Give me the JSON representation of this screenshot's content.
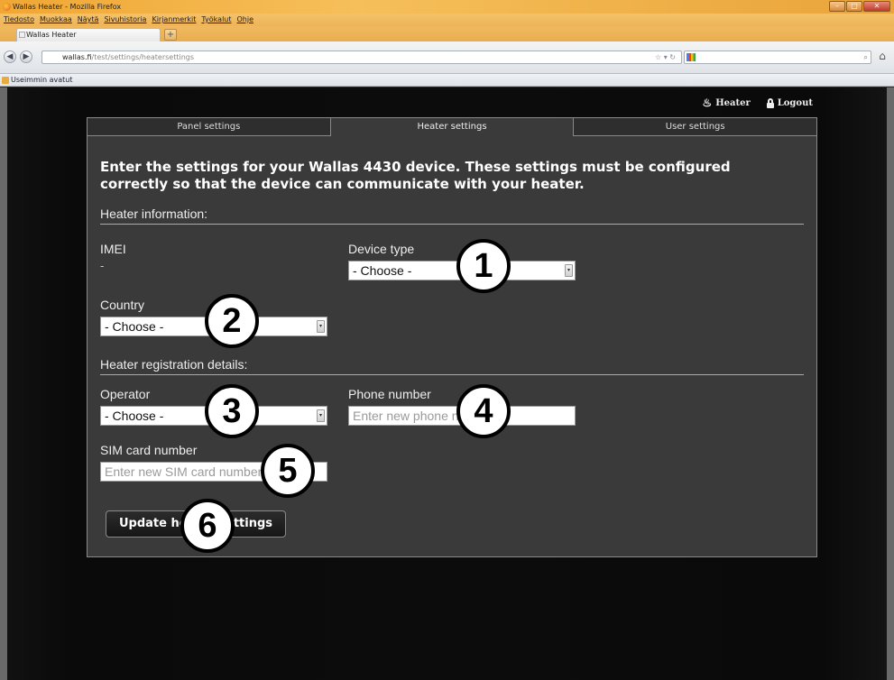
{
  "browser": {
    "window_title": "Wallas Heater - Mozilla Firefox",
    "menu": [
      "Tiedosto",
      "Muokkaa",
      "Näytä",
      "Sivuhistoria",
      "Kirjanmerkit",
      "Työkalut",
      "Ohje"
    ],
    "tab_title": "Wallas Heater",
    "new_tab": "+",
    "url_prefix": "",
    "url_host": "wallas.fi",
    "url_path": "/test/settings/heatersettings",
    "bookmark": "Useimmin avatut",
    "window_buttons": {
      "minimize": "–",
      "maximize": "□",
      "close": "✕"
    }
  },
  "topnav": {
    "heater_label": "Heater",
    "logout_label": "Logout"
  },
  "tabs": [
    {
      "label": "Panel settings",
      "active": false
    },
    {
      "label": "Heater settings",
      "active": true
    },
    {
      "label": "User settings",
      "active": false
    }
  ],
  "intro": "Enter the settings for your Wallas 4430 device. These settings must be configured correctly so that the device can communicate with your heater.",
  "sections": {
    "info_title": "Heater information:",
    "registration_title": "Heater registration details:"
  },
  "fields": {
    "imei_label": "IMEI",
    "imei_value": "-",
    "device_type_label": "Device type",
    "device_type_value": "- Choose -",
    "country_label": "Country",
    "country_value": "- Choose -",
    "operator_label": "Operator",
    "operator_value": "- Choose -",
    "phone_label": "Phone number",
    "phone_placeholder": "Enter new phone number",
    "sim_label": "SIM card number",
    "sim_placeholder": "Enter new SIM card number"
  },
  "submit_label": "Update heater settings",
  "callouts": [
    "1",
    "2",
    "3",
    "4",
    "5",
    "6"
  ]
}
